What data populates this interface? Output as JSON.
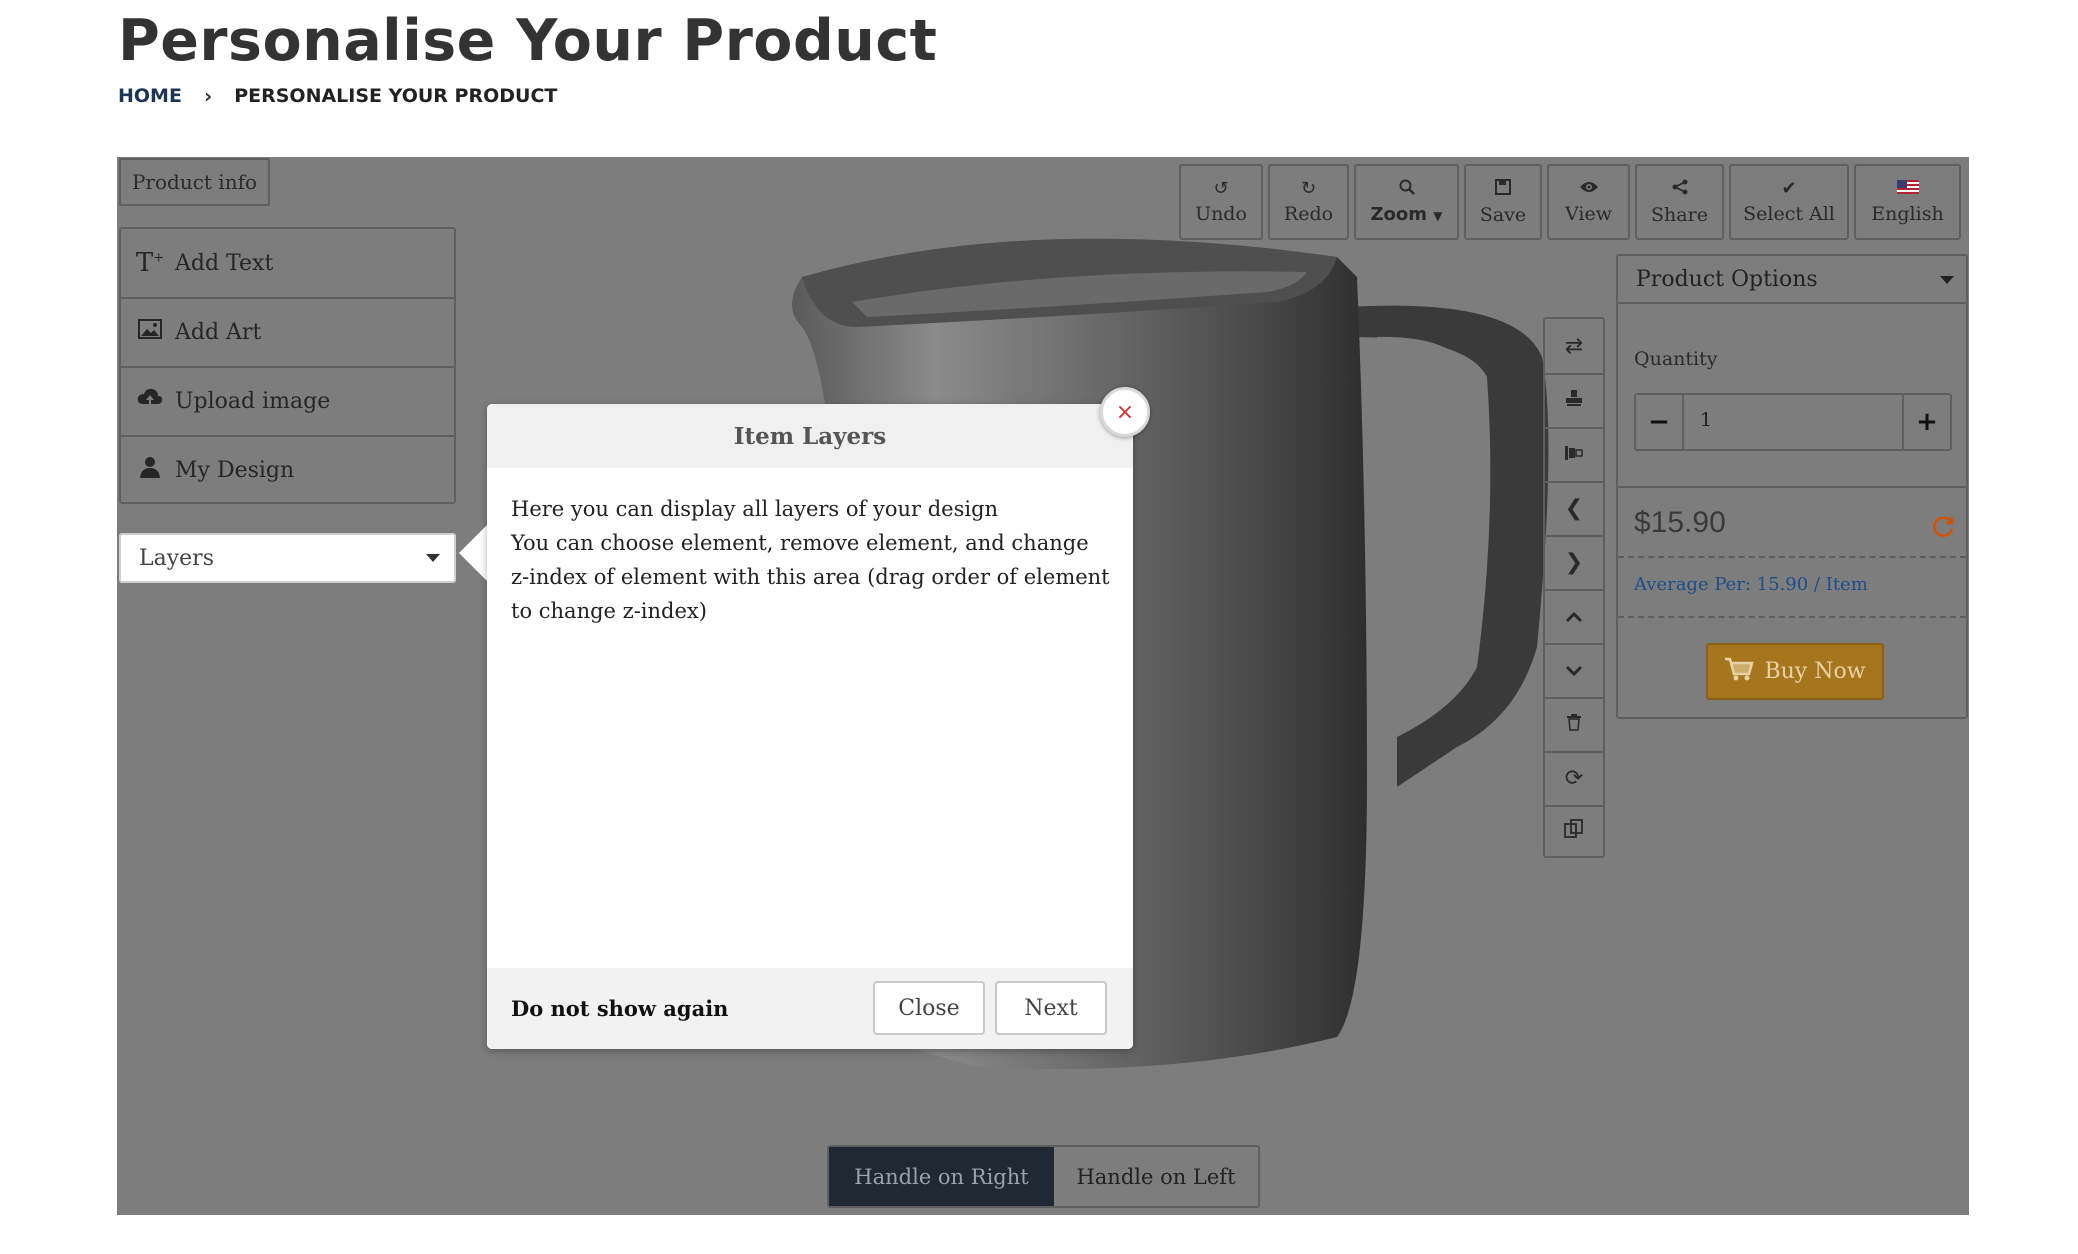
{
  "page": {
    "title": "Personalise Your Product"
  },
  "breadcrumb": {
    "home": "HOME",
    "separator": "›",
    "current": "PERSONALISE YOUR PRODUCT"
  },
  "sidebar": {
    "product_info": "Product info",
    "items": [
      {
        "label": "Add Text",
        "icon": "add-text-icon",
        "glyph": "T+"
      },
      {
        "label": "Add Art",
        "icon": "image-icon",
        "glyph": "🖼"
      },
      {
        "label": "Upload image",
        "icon": "cloud-upload-icon",
        "glyph": "☁"
      },
      {
        "label": "My Design",
        "icon": "user-icon",
        "glyph": "👤"
      }
    ],
    "layers_label": "Layers"
  },
  "toolbar": {
    "undo": "Undo",
    "redo": "Redo",
    "zoom": "Zoom",
    "save": "Save",
    "view": "View",
    "share": "Share",
    "select_all": "Select All",
    "language": "English"
  },
  "vertical_tools": [
    "swap-icon",
    "stamp-icon",
    "align-icon",
    "arrow-left-icon",
    "arrow-right-icon",
    "arrow-up-icon",
    "arrow-down-icon",
    "trash-icon",
    "refresh-icon",
    "copy-icon"
  ],
  "product_options": {
    "title": "Product Options",
    "quantity_label": "Quantity",
    "quantity": "1",
    "price": "$15.90",
    "average": "Average Per: 15.90 / Item",
    "buy_now": "Buy Now"
  },
  "handles": {
    "right": "Handle on Right",
    "left": "Handle on Left",
    "selected": "right"
  },
  "popover": {
    "title": "Item Layers",
    "line1": "Here you can display all layers of your design",
    "line2": "You can choose element, remove element, and change z-index of element with this area (drag order of element to change z-index)",
    "dont_show": "Do not show again",
    "close": "Close",
    "next": "Next",
    "close_x": "×"
  },
  "colors": {
    "stage": "#7d7d7d",
    "buy_button": "#a6761f",
    "handle_selected": "#202833",
    "close_x": "#d63031",
    "link": "#1d4e89"
  }
}
